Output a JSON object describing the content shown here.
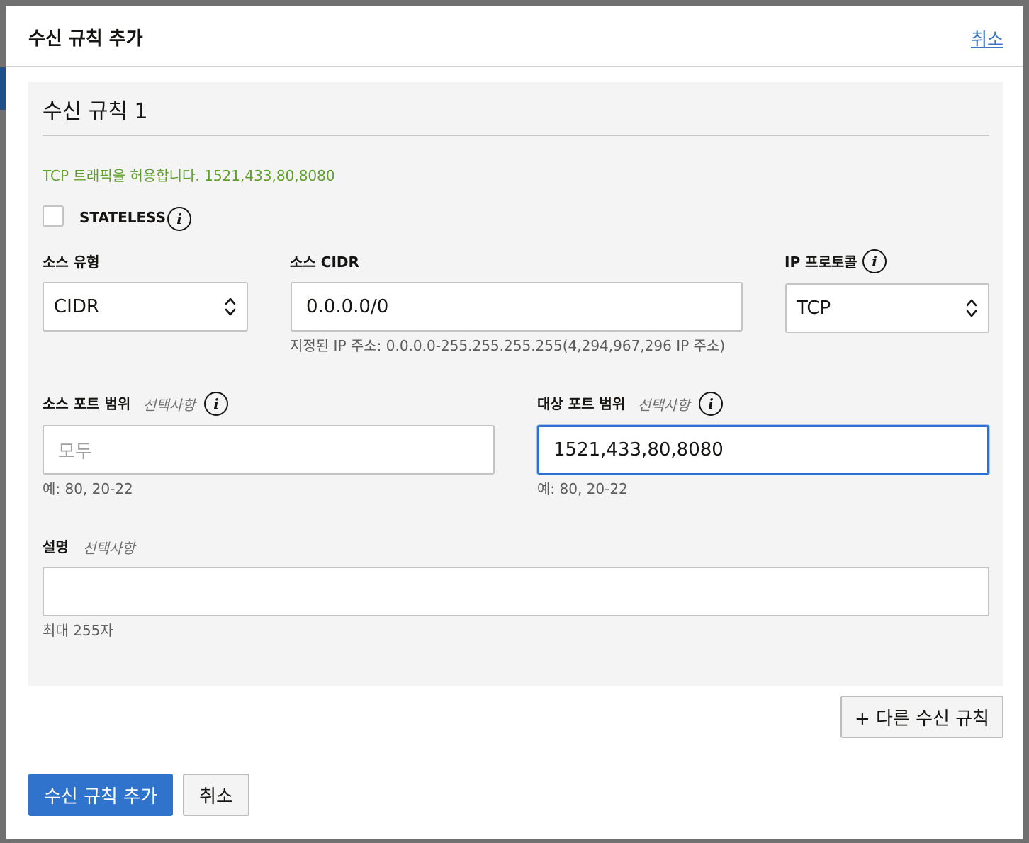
{
  "dialog": {
    "title": "수신 규칙 추가",
    "header_cancel": "취소"
  },
  "rule": {
    "title": "수신 규칙 1",
    "allow_note": "TCP 트래픽을 허용합니다. 1521,433,80,8080",
    "stateless": {
      "label": "STATELESS",
      "checked": false
    },
    "source_type": {
      "label": "소스 유형",
      "value": "CIDR"
    },
    "source_cidr": {
      "label": "소스 CIDR",
      "value": "0.0.0.0/0",
      "help": "지정된 IP 주소: 0.0.0.0-255.255.255.255(4,294,967,296 IP 주소)"
    },
    "ip_protocol": {
      "label": "IP 프로토콜",
      "value": "TCP"
    },
    "source_port": {
      "label": "소스 포트 범위",
      "optional": "선택사항",
      "placeholder": "모두",
      "value": "",
      "help": "예: 80, 20-22"
    },
    "dest_port": {
      "label": "대상 포트 범위",
      "optional": "선택사항",
      "value": "1521,433,80,8080",
      "help": "예: 80, 20-22"
    },
    "description": {
      "label": "설명",
      "optional": "선택사항",
      "value": "",
      "help": "최대 255자"
    }
  },
  "buttons": {
    "add_another": "+ 다른 수신 규칙",
    "submit": "수신 규칙 추가",
    "cancel": "취소"
  },
  "icons": {
    "info": "i"
  },
  "colors": {
    "primary": "#2f73cc",
    "link": "#3a75c4",
    "success_text": "#5fa02b",
    "focus_border": "#2f6fd0"
  }
}
